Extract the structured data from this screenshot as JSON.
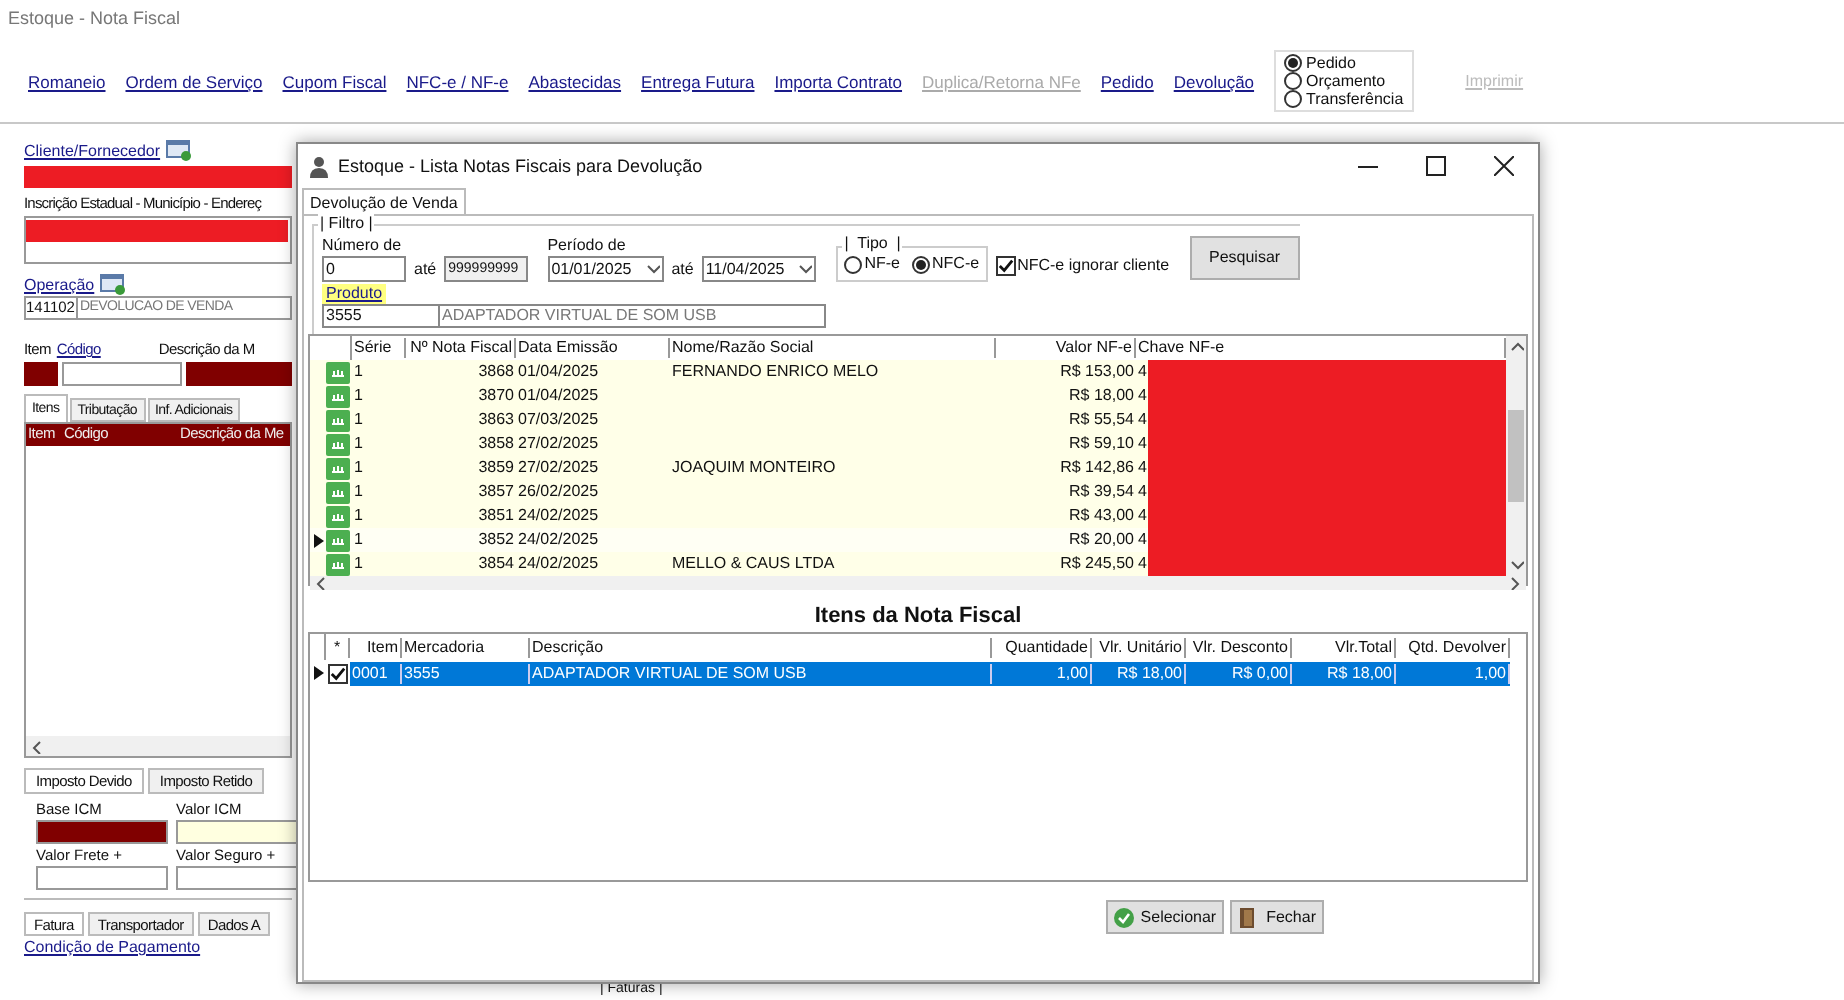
{
  "window": {
    "title": "Estoque - Nota Fiscal"
  },
  "menu": [
    {
      "label": "Romaneio",
      "disabled": false
    },
    {
      "label": "Ordem de Serviço",
      "disabled": false
    },
    {
      "label": "Cupom Fiscal",
      "disabled": false
    },
    {
      "label": "NFC-e / NF-e",
      "disabled": false
    },
    {
      "label": "Abastecidas",
      "disabled": false
    },
    {
      "label": "Entrega Futura",
      "disabled": false
    },
    {
      "label": "Importa Contrato",
      "disabled": false
    },
    {
      "label": "Duplica/Retorna NFe",
      "disabled": true
    },
    {
      "label": "Pedido",
      "disabled": false
    },
    {
      "label": "Devolução",
      "disabled": false
    }
  ],
  "order_type": [
    {
      "label": "Pedido",
      "selected": true
    },
    {
      "label": "Orçamento",
      "selected": false
    },
    {
      "label": "Transferência",
      "selected": false
    }
  ],
  "print_button": {
    "label": "Imprimir",
    "disabled": true
  },
  "left_panel": {
    "client_label": "Cliente/Fornecedor",
    "address_label": "Inscrição Estadual - Município - Endereç",
    "operation_label": "Operação",
    "operation_code": "141102",
    "operation_name": "DEVOLUCAO DE VENDA",
    "item_header": {
      "item": "Item",
      "code": "Código",
      "description": "Descrição da M"
    },
    "tabs": [
      {
        "label": "Itens",
        "selected": true
      },
      {
        "label": "Tributação",
        "selected": false
      },
      {
        "label": "Inf. Adicionais",
        "selected": false
      }
    ],
    "grid_columns": [
      "Item",
      "Código",
      "Descrição da Me"
    ],
    "tax_tabs": [
      {
        "label": "Imposto Devido",
        "selected": true
      },
      {
        "label": "Imposto Retido",
        "selected": false
      }
    ],
    "tax_fields": [
      {
        "label": "Base ICM",
        "color": "#800000"
      },
      {
        "label": "Valor ICM",
        "color": "#ffffe0"
      },
      {
        "label": "Valor Frete +",
        "color": "#ffffff"
      },
      {
        "label": "Valor Seguro +",
        "color": "#ffffff"
      }
    ],
    "bottom_tabs": [
      {
        "label": "Fatura",
        "selected": true
      },
      {
        "label": "Transportador",
        "selected": false
      },
      {
        "label": "Dados A",
        "selected": false
      }
    ],
    "payment_link": "Condição de Pagamento",
    "faturas_label": "| Faturas |"
  },
  "dialog": {
    "title": "Estoque - Lista Notas Fiscais para Devolução",
    "tab": {
      "label": "Devolução de Venda",
      "selected": true
    },
    "filter": {
      "group": "| Filtro |",
      "number_label": "Número de",
      "number_from": "0",
      "until": "até",
      "number_to": "999999999",
      "period_label": "Período de",
      "date_from": "01/01/2025",
      "date_to": "11/04/2025",
      "until2": "até",
      "type_group": "|  Tipo  |",
      "types": [
        {
          "label": "NF-e",
          "selected": false
        },
        {
          "label": "NFC-e",
          "selected": true
        }
      ],
      "ignore_client": {
        "label": "NFC-e ignorar cliente",
        "checked": true
      },
      "search_button": "Pesquisar",
      "product_label": "Produto",
      "product_code": "3555",
      "product_name": "ADAPTADOR VIRTUAL DE SOM USB"
    },
    "invoice_columns": [
      "Série",
      "Nº Nota Fiscal",
      "Data Emissão",
      "Nome/Razão Social",
      "Valor NF-e",
      "Chave NF-e"
    ],
    "invoices": [
      {
        "serie": "1",
        "number": "3868",
        "date": "01/04/2025",
        "name": "FERNANDO ENRICO MELO",
        "value": "R$ 153,00",
        "key": "4",
        "current": false
      },
      {
        "serie": "1",
        "number": "3870",
        "date": "01/04/2025",
        "value": "R$ 18,00",
        "key": "4",
        "current": false
      },
      {
        "serie": "1",
        "number": "3863",
        "date": "07/03/2025",
        "value": "R$ 55,54",
        "key": "4",
        "current": false
      },
      {
        "serie": "1",
        "number": "3858",
        "date": "27/02/2025",
        "value": "R$ 59,10",
        "key": "4",
        "current": false
      },
      {
        "serie": "1",
        "number": "3859",
        "date": "27/02/2025",
        "name": "JOAQUIM MONTEIRO",
        "value": "R$ 142,86",
        "key": "4",
        "current": false
      },
      {
        "serie": "1",
        "number": "3857",
        "date": "26/02/2025",
        "value": "R$ 39,54",
        "key": "4",
        "current": false
      },
      {
        "serie": "1",
        "number": "3851",
        "date": "24/02/2025",
        "value": "R$ 43,00",
        "key": "4",
        "current": false
      },
      {
        "serie": "1",
        "number": "3852",
        "date": "24/02/2025",
        "value": "R$ 20,00",
        "key": "4",
        "current": true
      },
      {
        "serie": "1",
        "number": "3854",
        "date": "24/02/2025",
        "name": "MELLO & CAUS LTDA",
        "value": "R$ 245,50",
        "key": "4",
        "current": false
      }
    ],
    "items_title": "Itens da Nota Fiscal",
    "item_columns": [
      "*",
      "Item",
      "Mercadoria",
      "Descrição",
      "Quantidade",
      "Vlr. Unitário",
      "Vlr. Desconto",
      "Vlr.Total",
      "Qtd. Devolver"
    ],
    "items": [
      {
        "checked": true,
        "selected": true,
        "cells": [
          "0001",
          "3555",
          "ADAPTADOR VIRTUAL DE SOM USB",
          "1,00",
          "R$ 18,00",
          "R$ 0,00",
          "R$ 18,00",
          "1,00"
        ]
      }
    ],
    "buttons": [
      {
        "label": "Selecionar",
        "kind": "select"
      },
      {
        "label": "Fechar",
        "kind": "close"
      }
    ]
  }
}
